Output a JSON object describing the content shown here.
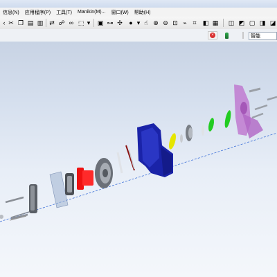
{
  "menubar": {
    "items": [
      "信息(N)",
      "应用程序(P)",
      "工具(T)",
      "Manikin(M)...",
      "窗口(W)",
      "帮助(H)"
    ]
  },
  "toolbar": {
    "buttons": [
      "cut-icon",
      "copy-icon",
      "paste-icon",
      "copy-special-icon",
      "regenerate-icon",
      "find-icon",
      "select-box-icon",
      "repaint-icon",
      "orient-icon",
      "spin-center-icon",
      "display-style-icon",
      "zoom-in-icon",
      "zoom-out-icon",
      "refit-icon",
      "annotation-icon",
      "sketch-display-icon",
      "saved-views-icon",
      "layer-icon",
      "model-icon",
      "appearance-icon"
    ]
  },
  "filter": {
    "value": "智能"
  },
  "colors": {
    "viewport_top": "#c8d3e4",
    "viewport_bottom": "#f4f7fb",
    "housing_blue": "#1a23a8",
    "red_part": "#ee1111",
    "green_ring": "#22cc22",
    "yellow_ring": "#e6e600",
    "purple_flange": "#c07ad0",
    "axis_line": "#3b6fd8"
  }
}
